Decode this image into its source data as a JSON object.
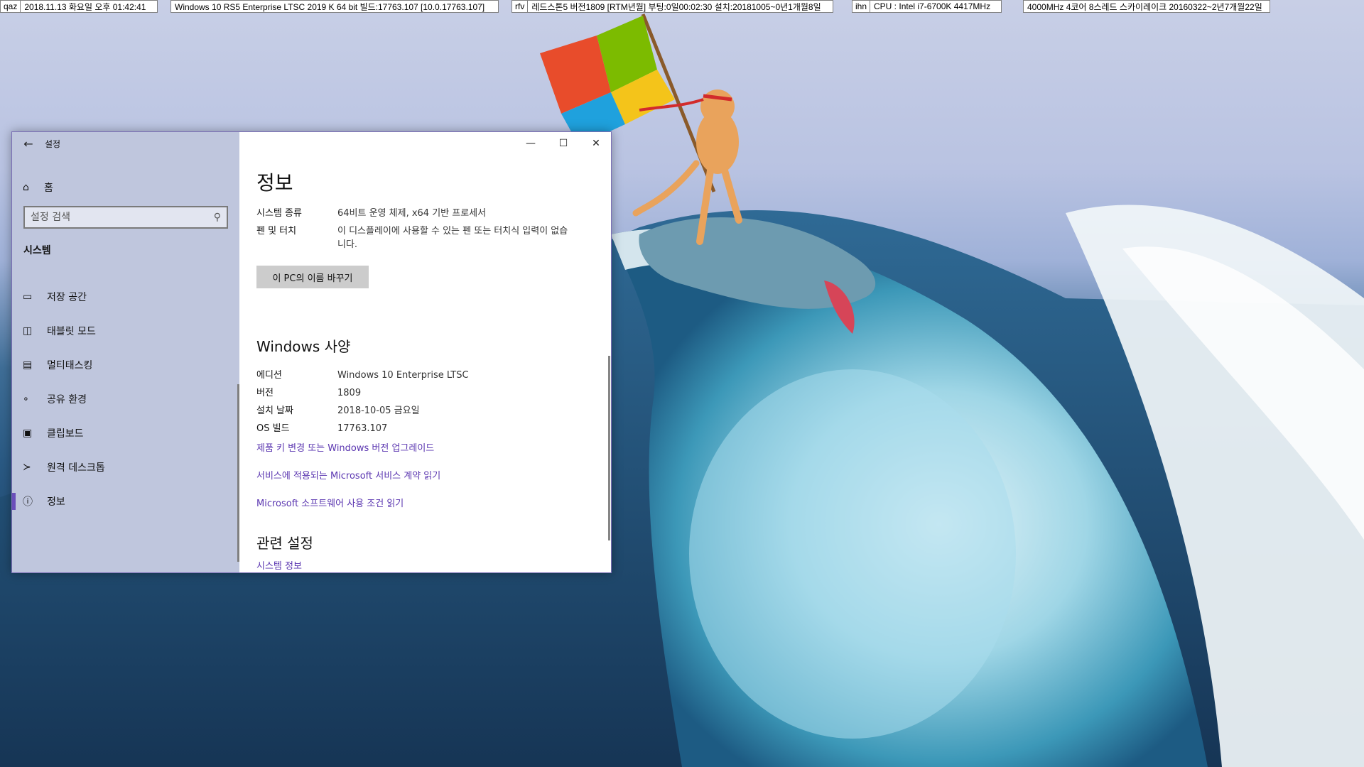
{
  "infobar": [
    {
      "tag": "qaz",
      "value": "2018.11.13 화요일 오후 01:42:41"
    },
    {
      "tag": "",
      "value": "Windows 10 RS5 Enterprise LTSC 2019 K 64 bit 빌드:17763.107 [10.0.17763.107]"
    },
    {
      "tag": "rfv",
      "value": "레드스톤5 버전1809 [RTM년월] 부팅:0일00:02:30 설치:20181005~0년1개월8일"
    },
    {
      "tag": "ihn",
      "value": "CPU : Intel i7-6700K 4417MHz"
    },
    {
      "tag": "",
      "value": "4000MHz 4코어 8스레드 스카이레이크 20160322~2년7개월22일"
    }
  ],
  "window": {
    "app_title": "설정",
    "back_icon": "arrow-left-icon",
    "controls": {
      "minimize": "—",
      "maximize": "☐",
      "close": "✕"
    }
  },
  "sidebar": {
    "home_label": "홈",
    "search_placeholder": "설정 검색",
    "section_title": "시스템",
    "items": [
      {
        "label": "저장 공간",
        "icon": "storage-icon"
      },
      {
        "label": "태블릿 모드",
        "icon": "tablet-mode-icon"
      },
      {
        "label": "멀티태스킹",
        "icon": "multitasking-icon"
      },
      {
        "label": "공유 환경",
        "icon": "shared-experience-icon"
      },
      {
        "label": "클립보드",
        "icon": "clipboard-icon"
      },
      {
        "label": "원격 데스크톱",
        "icon": "remote-desktop-icon"
      },
      {
        "label": "정보",
        "icon": "info-icon",
        "selected": true
      }
    ]
  },
  "content": {
    "title": "정보",
    "device_specs": [
      {
        "key": "시스템 종류",
        "value": "64비트 운영 체제, x64 기반 프로세서"
      },
      {
        "key": "펜 및 터치",
        "value": "이 디스플레이에 사용할 수 있는 펜 또는 터치식 입력이 없습니다."
      }
    ],
    "rename_button": "이 PC의 이름 바꾸기",
    "windows_spec_title": "Windows 사양",
    "windows_specs": [
      {
        "key": "에디션",
        "value": "Windows 10 Enterprise LTSC"
      },
      {
        "key": "버전",
        "value": "1809"
      },
      {
        "key": "설치 날짜",
        "value": "2018-10-05 금요일"
      },
      {
        "key": "OS 빌드",
        "value": "17763.107"
      }
    ],
    "links": [
      "제품 키 변경 또는 Windows 버전 업그레이드",
      "서비스에 적용되는 Microsoft 서비스 계약 읽기",
      "Microsoft 소프트웨어 사용 조건 읽기"
    ],
    "related_title": "관련 설정",
    "related_link": "시스템 정보",
    "link_color": "#5a35b0",
    "accent_color": "#6b4fbb"
  }
}
